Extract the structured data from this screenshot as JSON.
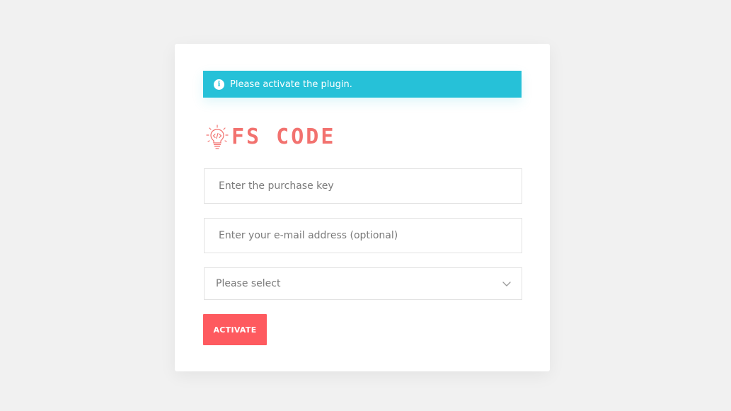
{
  "alert": {
    "icon": "info-icon",
    "text": "Please activate the plugin.",
    "color": "#26c1d8"
  },
  "logo": {
    "icon": "lightbulb-code-icon",
    "text": "FS CODE",
    "color": "#f2726f"
  },
  "form": {
    "purchase_key": {
      "placeholder": "Enter the purchase key",
      "value": ""
    },
    "email": {
      "placeholder": "Enter your e-mail address (optional)",
      "value": ""
    },
    "select": {
      "selected": "Please select",
      "icon": "chevron-down-icon"
    },
    "activate_label": "ACTIVATE",
    "button_color": "#fe5a5f"
  }
}
